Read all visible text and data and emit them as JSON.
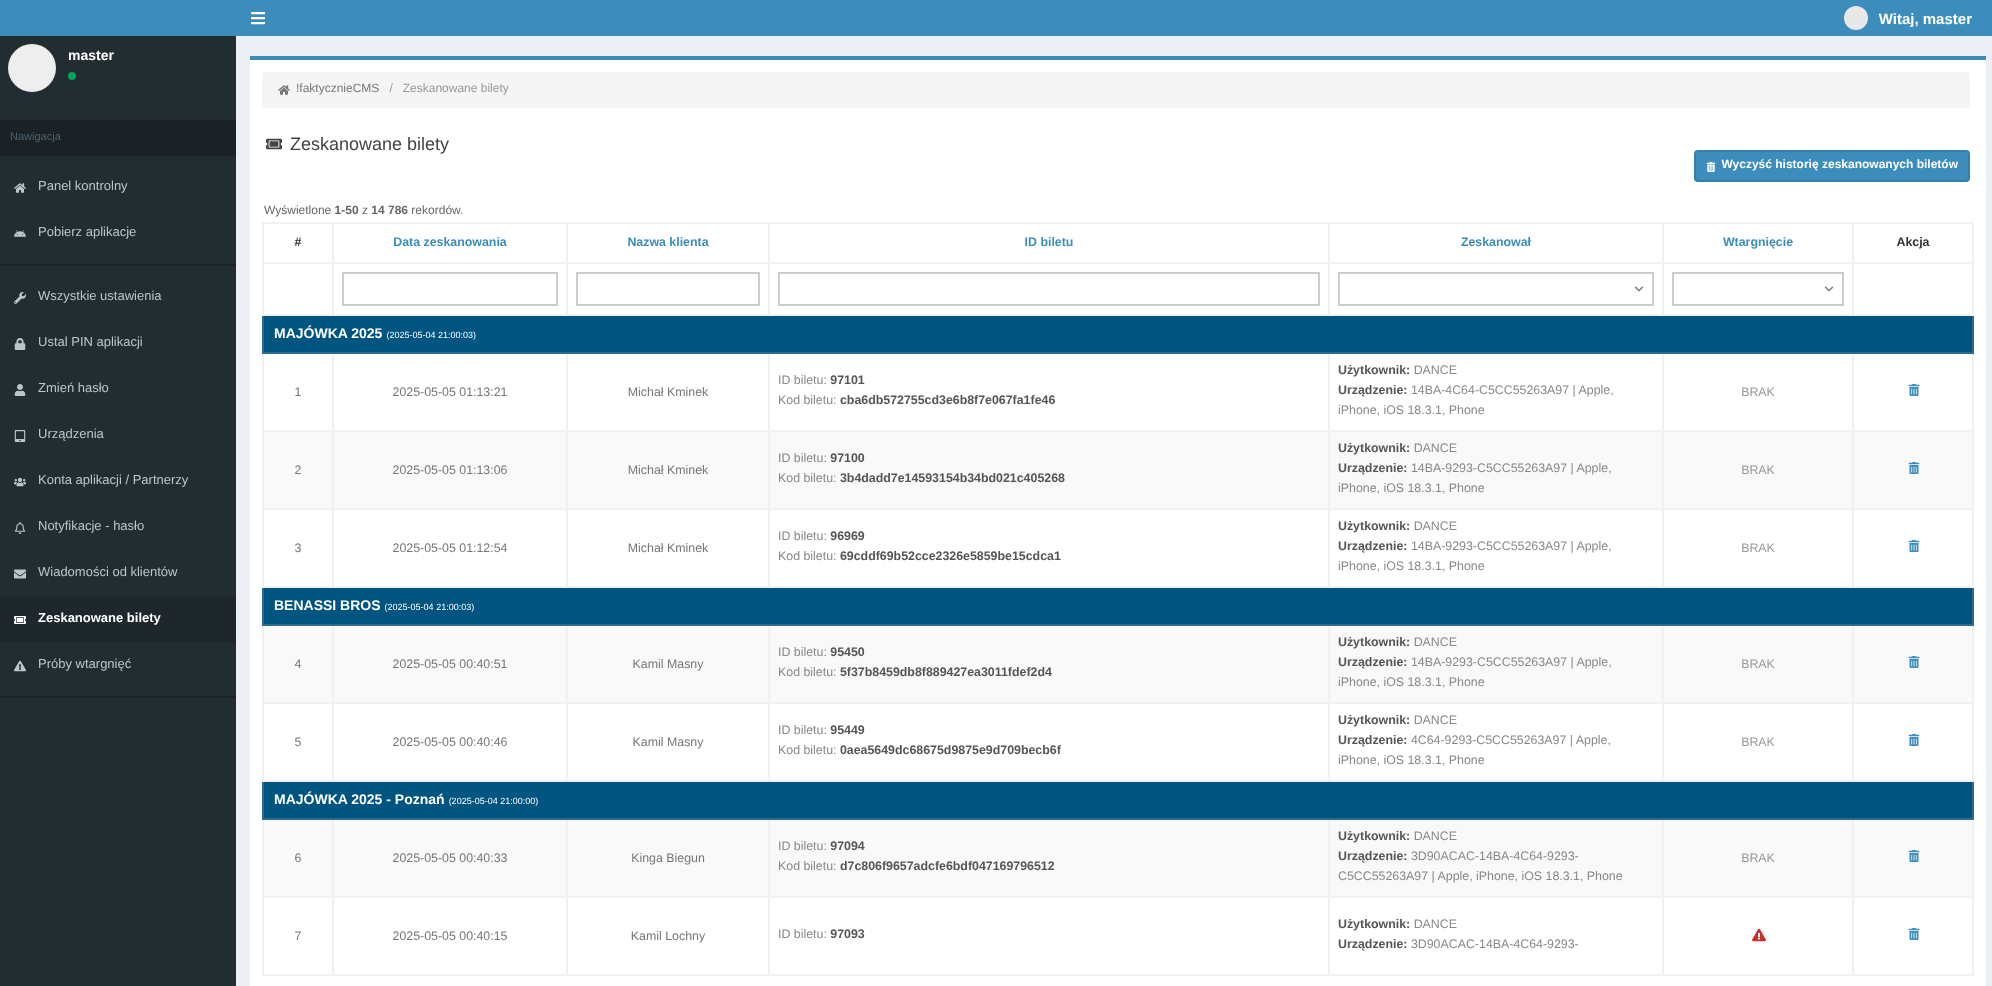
{
  "topbar": {
    "greeting": "Witaj, master"
  },
  "sidebar": {
    "user": {
      "name": "master",
      "online": true
    },
    "nav_header": "Nawigacja",
    "sections": [
      {
        "items": [
          {
            "label": "Panel kontrolny",
            "selected": false
          },
          {
            "label": "Pobierz aplikacje",
            "selected": false
          }
        ]
      },
      {
        "items": [
          {
            "label": "Wszystkie ustawienia",
            "selected": false
          },
          {
            "label": "Ustal PIN aplikacji",
            "selected": false
          },
          {
            "label": "Zmień hasło",
            "selected": false
          },
          {
            "label": "Urządzenia",
            "selected": false
          },
          {
            "label": "Konta aplikacji / Partnerzy",
            "selected": false
          },
          {
            "label": "Notyfikacje - hasło",
            "selected": false
          },
          {
            "label": "Wiadomości od klientów",
            "selected": false
          },
          {
            "label": "Zeskanowane bilety",
            "selected": true
          },
          {
            "label": "Próby wtargnięć",
            "selected": false
          }
        ]
      }
    ]
  },
  "breadcrumb": {
    "home": "!faktycznieCMS",
    "separator": "/",
    "current": "Zeskanowane bilety"
  },
  "page_title": "Zeskanowane bilety",
  "clear_button": "Wyczyść historię zeskanowanych biletów",
  "summary": "Wyświetlone **1-50** z **14 786** rekordów.",
  "table": {
    "columns": [
      "#",
      "Data zeskanowania",
      "Nazwa klienta",
      "ID biletu",
      "Zeskanował",
      "Wtargnięcie",
      "Akcja"
    ],
    "filters": [
      {
        "kind": "none"
      },
      {
        "kind": "text"
      },
      {
        "kind": "text"
      },
      {
        "kind": "text"
      },
      {
        "kind": "select"
      },
      {
        "kind": "select"
      },
      {
        "kind": "none"
      }
    ],
    "groups": [
      {
        "name": "MAJÓWKA 2025",
        "date": "(2025-05-04 21:00:03)",
        "rows": [
          {
            "no": "1",
            "date": "2025-05-05 01:13:21",
            "client": "Michał Kminek",
            "ticket_id": "ID biletu: **97101**",
            "ticket_code": "Kod biletu: **cba6db572755cd3e6b8f7e067fa1fe46**",
            "user": "**Użytkownik:** DANCE",
            "device": "**Urządzenie:** 14BA-4C64-C5CC55263A97 | Apple, iPhone, iOS 18.3.1, Phone",
            "intrusion": {
              "kind": "none",
              "text": "BRAK"
            }
          },
          {
            "no": "2",
            "date": "2025-05-05 01:13:06",
            "client": "Michał Kminek",
            "ticket_id": "ID biletu: **97100**",
            "ticket_code": "Kod biletu: **3b4dadd7e14593154b34bd021c405268**",
            "user": "**Użytkownik:** DANCE",
            "device": "**Urządzenie:** 14BA-9293-C5CC55263A97 | Apple, iPhone, iOS 18.3.1, Phone",
            "intrusion": {
              "kind": "none",
              "text": "BRAK"
            }
          },
          {
            "no": "3",
            "date": "2025-05-05 01:12:54",
            "client": "Michał Kminek",
            "ticket_id": "ID biletu: **96969**",
            "ticket_code": "Kod biletu: **69cddf69b52cce2326e5859be15cdca1**",
            "user": "**Użytkownik:** DANCE",
            "device": "**Urządzenie:** 14BA-9293-C5CC55263A97 | Apple, iPhone, iOS 18.3.1, Phone",
            "intrusion": {
              "kind": "none",
              "text": "BRAK"
            }
          }
        ]
      },
      {
        "name": "BENASSI BROS",
        "date": "(2025-05-04 21:00:03)",
        "rows": [
          {
            "no": "4",
            "date": "2025-05-05 00:40:51",
            "client": "Kamil Masny",
            "ticket_id": "ID biletu: **95450**",
            "ticket_code": "Kod biletu: **5f37b8459db8f889427ea3011fdef2d4**",
            "user": "**Użytkownik:** DANCE",
            "device": "**Urządzenie:** 14BA-9293-C5CC55263A97 | Apple, iPhone, iOS 18.3.1, Phone",
            "intrusion": {
              "kind": "none",
              "text": "BRAK"
            }
          },
          {
            "no": "5",
            "date": "2025-05-05 00:40:46",
            "client": "Kamil Masny",
            "ticket_id": "ID biletu: **95449**",
            "ticket_code": "Kod biletu: **0aea5649dc68675d9875e9d709becb6f**",
            "user": "**Użytkownik:** DANCE",
            "device": "**Urządzenie:** 4C64-9293-C5CC55263A97 | Apple, iPhone, iOS 18.3.1, Phone",
            "intrusion": {
              "kind": "none",
              "text": "BRAK"
            }
          }
        ]
      },
      {
        "name": "MAJÓWKA 2025 - Poznań",
        "date": "(2025-05-04 21:00:00)",
        "rows": [
          {
            "no": "6",
            "date": "2025-05-05 00:40:33",
            "client": "Kinga Biegun",
            "ticket_id": "ID biletu: **97094**",
            "ticket_code": "Kod biletu: **d7c806f9657adcfe6bdf047169796512**",
            "user": "**Użytkownik:** DANCE",
            "device": "**Urządzenie:** 3D90ACAC-14BA-4C64-9293-C5CC55263A97 | Apple, iPhone, iOS 18.3.1, Phone",
            "intrusion": {
              "kind": "none",
              "text": "BRAK"
            }
          },
          {
            "no": "7",
            "date": "2025-05-05 00:40:15",
            "client": "Kamil Lochny",
            "ticket_id": "ID biletu: **97093**",
            "user": "**Użytkownik:** DANCE",
            "device": "**Urządzenie:** 3D90ACAC-14BA-4C64-9293-",
            "intrusion": {
              "kind": "alert"
            }
          }
        ]
      }
    ]
  }
}
